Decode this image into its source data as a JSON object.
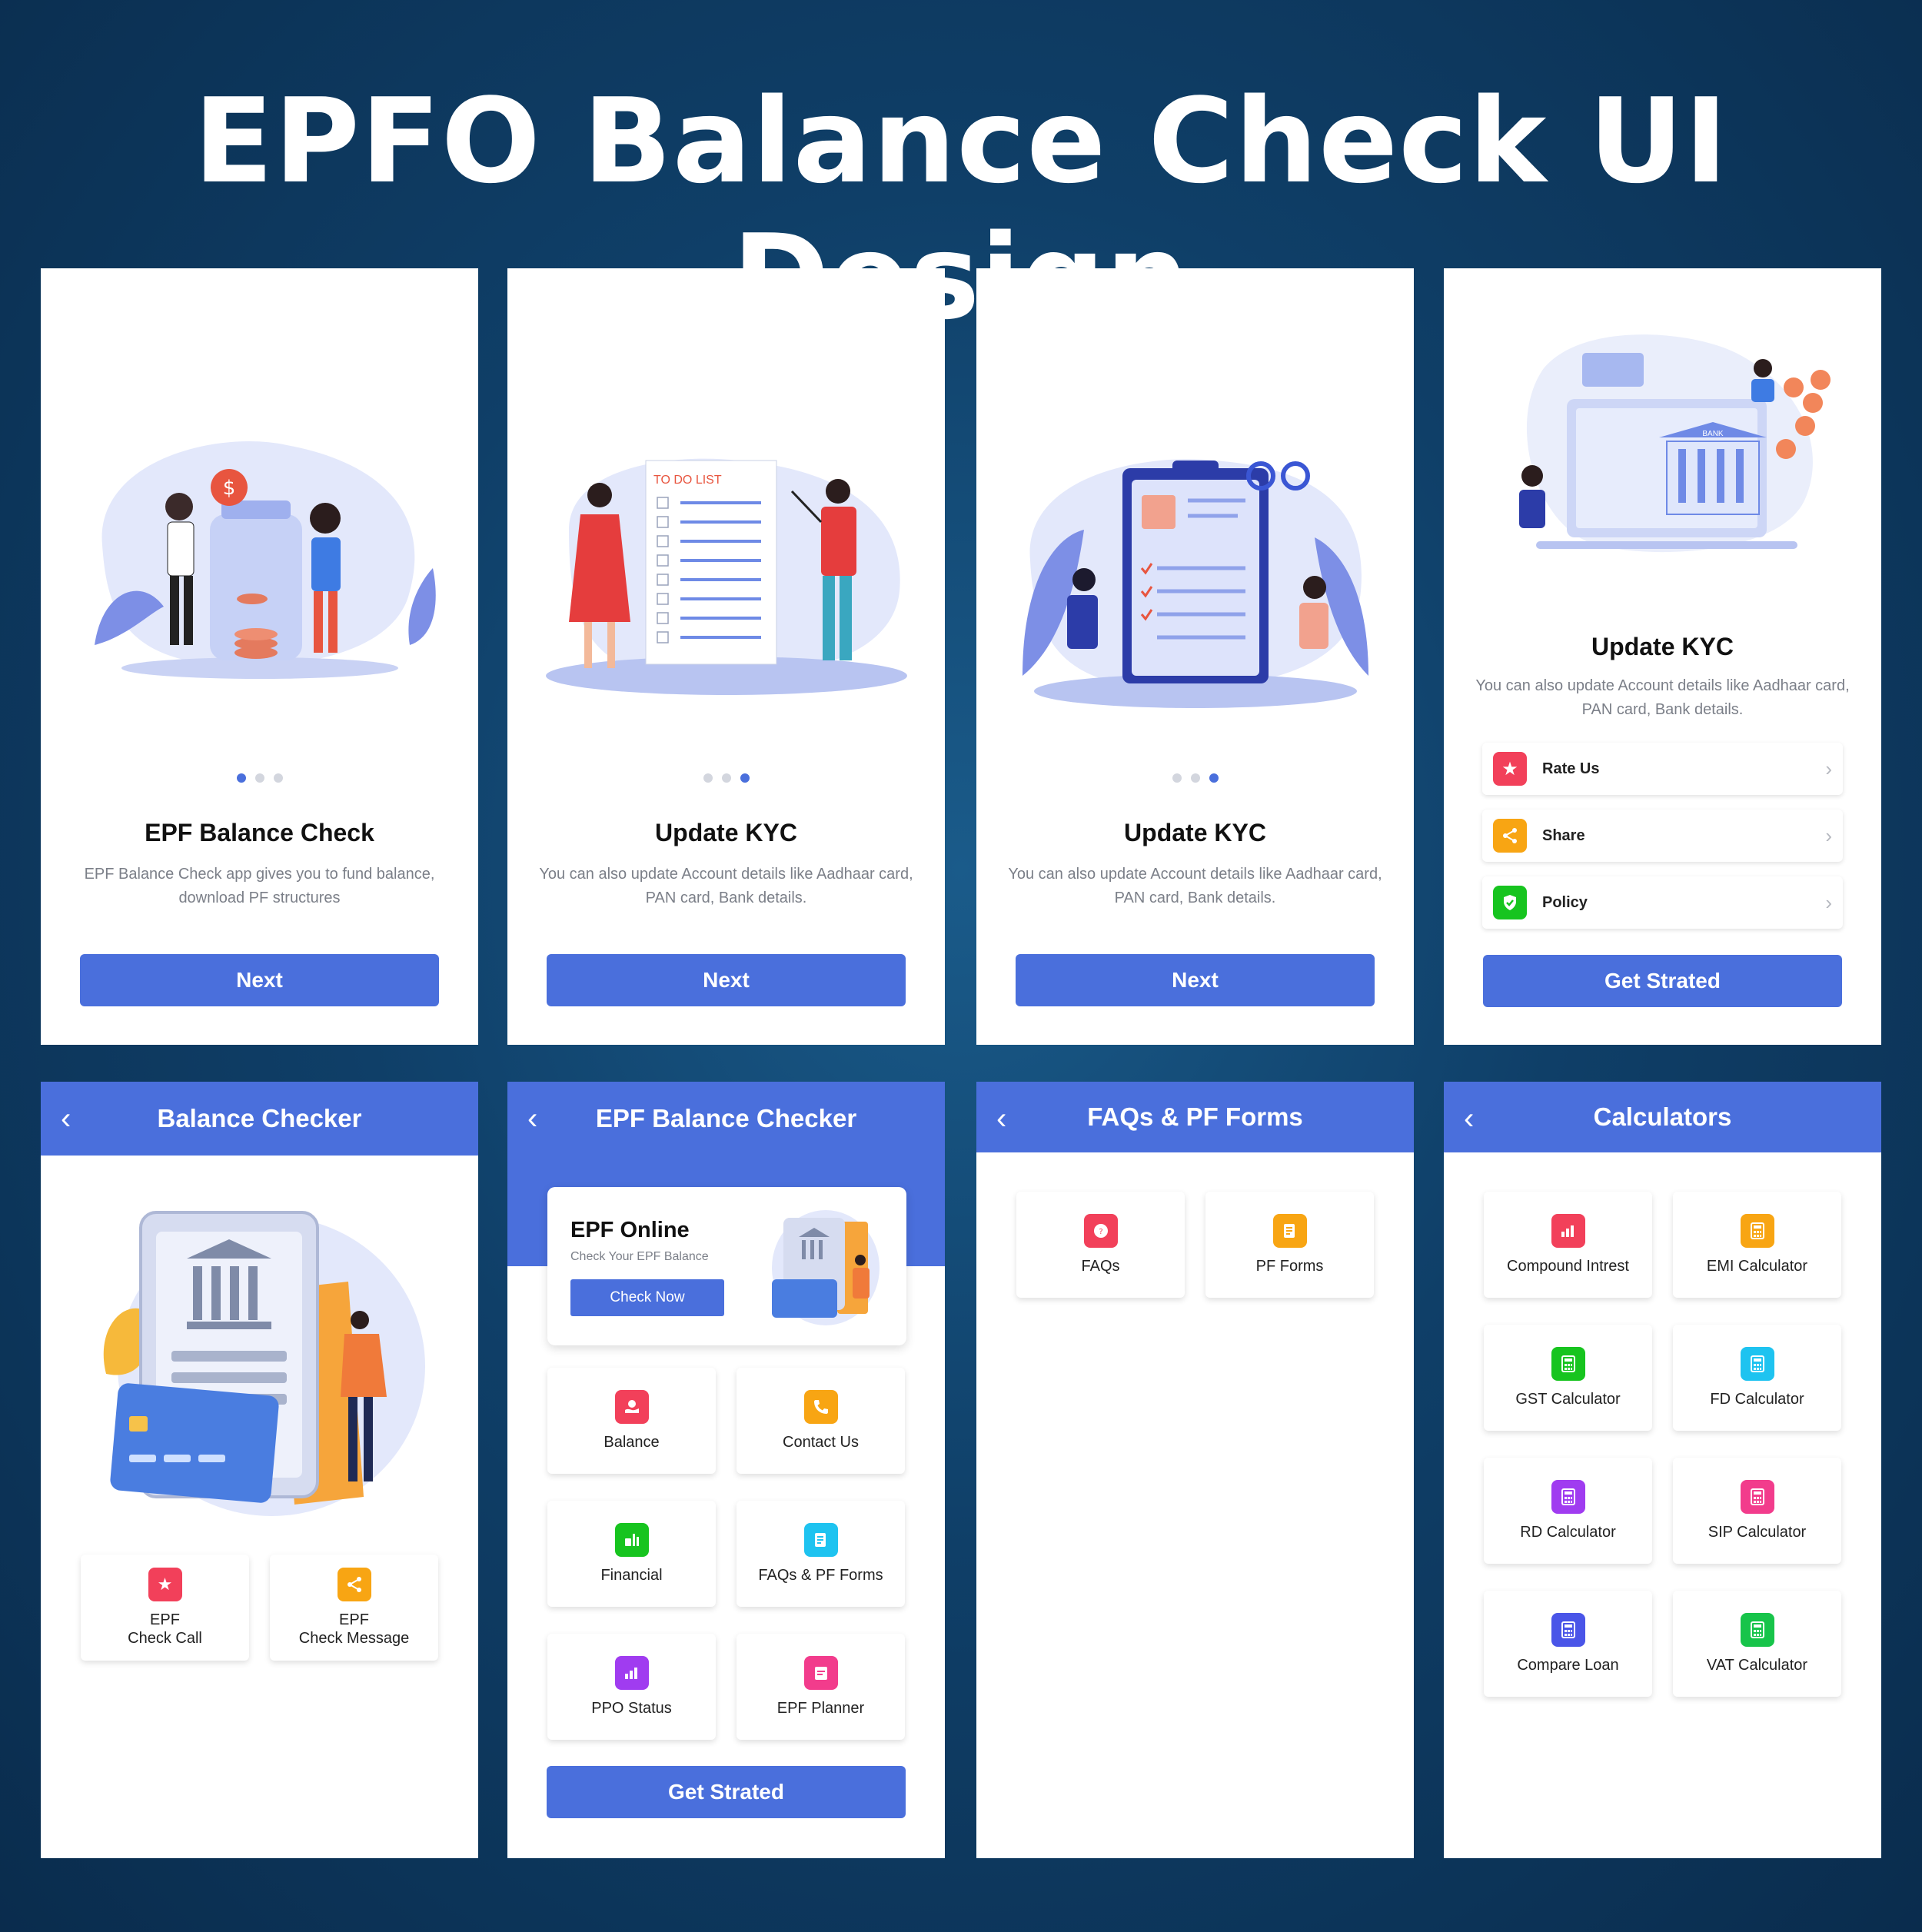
{
  "title": "EPFO Balance Check UI Design",
  "screen1": {
    "title": "EPF  Balance Check",
    "desc": "EPF Balance Check app gives you to fund balance, download PF structures",
    "button": "Next"
  },
  "screen2": {
    "todo": "TO DO LIST",
    "title": "Update KYC",
    "desc": "You can also update Account details like Aadhaar card, PAN card, Bank details.",
    "button": "Next"
  },
  "screen3": {
    "title": "Update KYC",
    "desc": "You can also update Account details like Aadhaar card, PAN card, Bank details.",
    "button": "Next"
  },
  "screen4": {
    "title": "Update KYC",
    "desc": "You can also update Account details like Aadhaar card, PAN card, Bank details.",
    "menu": [
      {
        "label": "Rate Us",
        "icon": "star-icon",
        "color": "#f2405a"
      },
      {
        "label": "Share",
        "icon": "share-icon",
        "color": "#f8a513"
      },
      {
        "label": "Policy",
        "icon": "shield-icon",
        "color": "#17c41f"
      }
    ],
    "bank_label": "BANK",
    "button": "Get Strated"
  },
  "screen5": {
    "appbar": "Balance Checker",
    "tiles": [
      {
        "label_line1": "EPF",
        "label_line2": "Check Call",
        "icon": "star-icon",
        "color": "#f2405a"
      },
      {
        "label_line1": "EPF",
        "label_line2": "Check Message",
        "icon": "share-icon",
        "color": "#f8a513"
      }
    ]
  },
  "screen6": {
    "appbar": "EPF Balance Checker",
    "card": {
      "title": "EPF Online",
      "subtitle": "Check Your EPF Balance",
      "button": "Check Now"
    },
    "tiles": [
      {
        "label": "Balance",
        "icon": "wallet-icon",
        "color": "#f2405a"
      },
      {
        "label": "Contact Us",
        "icon": "phone-icon",
        "color": "#f8a513"
      },
      {
        "label": "Financial",
        "icon": "finance-icon",
        "color": "#17c41f"
      },
      {
        "label": "FAQs & PF Forms",
        "icon": "form-icon",
        "color": "#1ec3f0"
      },
      {
        "label": "PPO Status",
        "icon": "chart-icon",
        "color": "#a03cf0"
      },
      {
        "label": "EPF Planner",
        "icon": "planner-icon",
        "color": "#f23c8c"
      }
    ],
    "button": "Get Strated"
  },
  "screen7": {
    "appbar": "FAQs & PF Forms",
    "tiles": [
      {
        "label": "FAQs",
        "icon": "faq-icon",
        "color": "#f2405a"
      },
      {
        "label": "PF Forms",
        "icon": "form-icon",
        "color": "#f8a513"
      }
    ]
  },
  "screen8": {
    "appbar": "Calculators",
    "tiles": [
      {
        "label": "Compound Intrest",
        "icon": "chart-icon",
        "color": "#f2405a"
      },
      {
        "label": "EMI Calculator",
        "icon": "calculator-icon",
        "color": "#f8a513"
      },
      {
        "label": "GST Calculator",
        "icon": "calculator-icon",
        "color": "#17c41f"
      },
      {
        "label": "FD Calculator",
        "icon": "calculator-icon",
        "color": "#1ec3f0"
      },
      {
        "label": "RD Calculator",
        "icon": "calculator-icon",
        "color": "#a03cf0"
      },
      {
        "label": "SIP Calculator",
        "icon": "calculator-icon",
        "color": "#f23c8c"
      },
      {
        "label": "Compare Loan",
        "icon": "calculator-icon",
        "color": "#4a55e8"
      },
      {
        "label": "VAT Calculator",
        "icon": "calculator-icon",
        "color": "#17c44a"
      }
    ]
  },
  "colors": {
    "primary": "#4a6fdc",
    "muted_text": "#7b7f88",
    "background": "#0f3f68"
  }
}
